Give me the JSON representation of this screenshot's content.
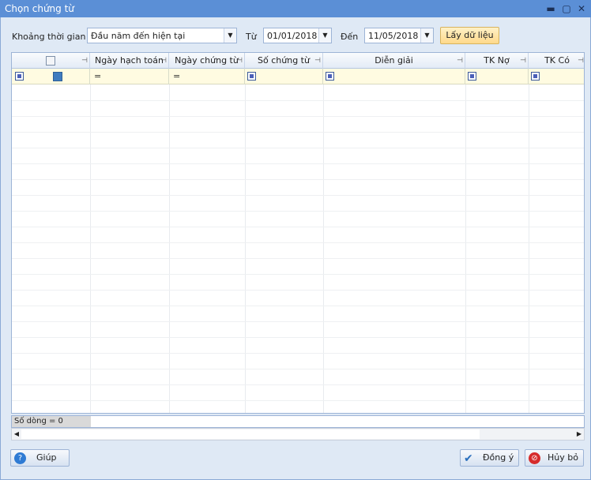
{
  "window": {
    "title": "Chọn chứng từ"
  },
  "filter": {
    "period_label": "Khoảng thời gian",
    "period_value": "Đầu năm đến hiện tại",
    "from_label": "Từ",
    "from_value": "01/01/2018",
    "to_label": "Đến",
    "to_value": "11/05/2018",
    "fetch_label": "Lấy dữ liệu"
  },
  "grid": {
    "columns": [
      "Ngày hạch toán",
      "Ngày chứng từ",
      "Số chứng từ",
      "Diễn giải",
      "TK Nợ",
      "TK Có"
    ],
    "filter_equals": "="
  },
  "footer": {
    "row_count": "Số dòng = 0"
  },
  "buttons": {
    "help": "Giúp",
    "ok": "Đồng ý",
    "cancel": "Hủy bỏ"
  },
  "colors": {
    "titlebar": "#5b8fd6",
    "filter_row": "#fffbe1",
    "fetch_button": "#ffd98a"
  }
}
